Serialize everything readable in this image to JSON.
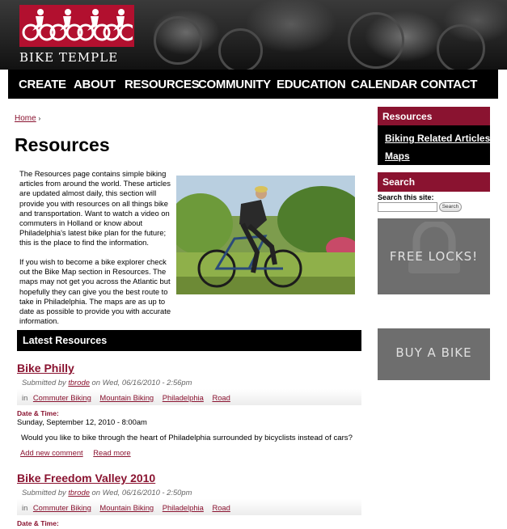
{
  "logo": {
    "text": "BIKE TEMPLE",
    "color": "#b2102f"
  },
  "nav": [
    "CREATE",
    "ABOUT",
    "RESOURCES",
    "COMMUNITY",
    "EDUCATION",
    "CALENDAR",
    "CONTACT"
  ],
  "breadcrumb": {
    "home": "Home",
    "sep": "›"
  },
  "page_title": "Resources",
  "intro": {
    "p1": "The Resources page contains simple biking articles from around the world. These articles are updated almost daily, this section will provide you with resources on all things bike and transportation. Want to watch a video on commuters in Holland or know about Philadelphia's latest bike plan for the future; this is the place to find the information.",
    "p2": "If you wish to become a bike explorer check out the Bike Map section in Resources.  The maps may not get you across the Atlantic but hopefully they can give you the best route to take in Philadelphia. The maps are as up to date as possible to provide you with accurate information."
  },
  "latest": {
    "heading": "Latest Resources"
  },
  "items": [
    {
      "title": "Bike Philly",
      "submitted_prefix": "Submitted by",
      "author": "tbrode",
      "submitted_suffix": "on Wed, 06/16/2010 - 2:56pm",
      "in": "in",
      "terms": [
        "Commuter Biking",
        "Mountain Biking",
        "Philadelphia",
        "Road"
      ],
      "dt_label": "Date & Time:",
      "dt_value": "Sunday, September 12, 2010 - 8:00am",
      "body": "Would you like to bike through the heart of Philadelphia surrounded by bicyclists instead of cars?",
      "links": [
        "Add new comment",
        "Read more"
      ]
    },
    {
      "title": "Bike Freedom Valley 2010",
      "submitted_prefix": "Submitted by",
      "author": "tbrode",
      "submitted_suffix": "on Wed, 06/16/2010 - 2:50pm",
      "in": "in",
      "terms": [
        "Commuter Biking",
        "Mountain Biking",
        "Philadelphia",
        "Road"
      ],
      "dt_label": "Date & Time:"
    }
  ],
  "sidebar": {
    "resources_heading": "Resources",
    "resources_links": [
      "Biking Related Articles",
      "Maps"
    ],
    "search_heading": "Search",
    "search_label": "Search this site:",
    "search_button": "Search",
    "promo_locks": "FREE LOCKS!",
    "promo_bike": "BUY A BIKE"
  },
  "colors": {
    "accent": "#8a1330",
    "nav_bg": "#000000",
    "promo_bg": "#6e6e6e"
  }
}
